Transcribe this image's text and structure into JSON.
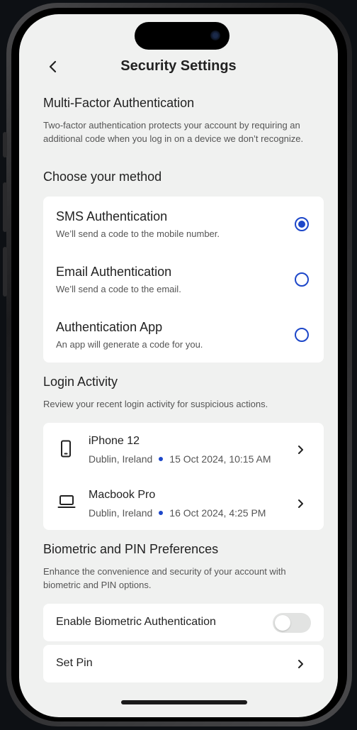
{
  "header": {
    "title": "Security Settings"
  },
  "mfa": {
    "heading": "Multi-Factor Authentication",
    "description": "Two-factor authentication protects your account by requiring an additional code when you log in on a device we don’t recognize.",
    "choose_heading": "Choose your method",
    "methods": [
      {
        "title": "SMS Authentication",
        "subtitle": "We’ll send a code to the mobile number.",
        "selected": true
      },
      {
        "title": "Email Authentication",
        "subtitle": "We’ll send a code to the email.",
        "selected": false
      },
      {
        "title": "Authentication App",
        "subtitle": "An app will generate a code for you.",
        "selected": false
      }
    ]
  },
  "login_activity": {
    "heading": "Login Activity",
    "description": "Review your recent login activity for suspicious actions.",
    "devices": [
      {
        "name": "iPhone 12",
        "location": "Dublin, Ireland",
        "datetime": "15 Oct 2024, 10:15 AM",
        "icon": "smartphone-icon"
      },
      {
        "name": "Macbook Pro",
        "location": "Dublin, Ireland",
        "datetime": "16 Oct 2024, 4:25 PM",
        "icon": "laptop-icon"
      }
    ]
  },
  "biometric": {
    "heading": "Biometric and PIN Preferences",
    "description": "Enhance the convenience and security of your account with biometric and PIN options.",
    "enable_label": "Enable Biometric Authentication",
    "enabled": false,
    "set_pin_label": "Set Pin"
  },
  "colors": {
    "accent": "#1d47c9",
    "background": "#f0f1f0",
    "card": "#ffffff"
  }
}
